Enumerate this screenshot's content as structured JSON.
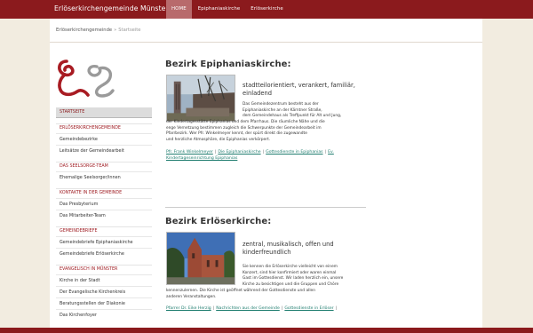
{
  "header": {
    "site_title": "Erlöserkirchengemeinde Münster",
    "nav": [
      {
        "label": "HOME"
      },
      {
        "label": "Epiphaniaskirche"
      },
      {
        "label": "Erlöserkirche"
      }
    ]
  },
  "breadcrumb": {
    "root": "Erlöserkirchengemeinde",
    "separator": "»",
    "current": "Startseite"
  },
  "sidebar": {
    "active": "STARTSEITE",
    "groups": [
      {
        "heading": "ERLÖSERKIRCHENGEMEINDE",
        "items": [
          "Gemeindebezirke",
          "Leitsätze der Gemeindearbeit"
        ]
      },
      {
        "heading": "DAS SEELSORGE-TEAM",
        "items": [
          "Ehemalige Seelsorger/innen"
        ]
      },
      {
        "heading": "KONTAKTE IN DER GEMEINDE",
        "items": [
          "Das Presbyterium",
          "Das Mitarbeiter-Team"
        ]
      },
      {
        "heading": "GEMEINDEBRIEFE",
        "items": [
          "Gemeindebriefe Epiphaniaskirche",
          "Gemeindebriefe Erlöserkirche"
        ]
      },
      {
        "heading": "EVANGELISCH IN MÜNSTER",
        "items": [
          "Kirche in der Stadt",
          "Der Evangelische Kirchenkreis",
          "Beratungsstellen der Diakonie",
          "Das Kirchenfoyer"
        ]
      }
    ]
  },
  "sections": [
    {
      "title": "Bezirk Epiphaniaskirche:",
      "tagline": "stadtteilorientiert, verankert, familiär, einladend",
      "description": [
        "Das Gemeindezentrum besteht aus der",
        "Epiphaniaskirche an der Kärntner Straße,",
        "dem Gemeindehaus als Treffpunkt für Alt und Jung,",
        "der Kindertagesstätte Epiphanias und dem Pfarrhaus. Die räumliche Nähe und die",
        "enge Vernetzung bestimmen zugleich die Schwerpunkte der Gemeindearbeit im",
        "Pfarrbezirk. Wer Pfr. Winkelmeyer kennt, der spürt direkt die zugewandte",
        "und herzliche Atmosphäre, die Epiphanias verkörpert."
      ],
      "links": [
        "Pfr. Frank Winkelmeyer",
        "Die Epiphaniaskirche",
        "Gottesdienste in Epiphanias",
        "Ev. Kindertageseinrichtung Epiphanias"
      ]
    },
    {
      "title": "Bezirk Erlöserkirche:",
      "tagline": "zentral, musikalisch, offen und kinderfreundlich",
      "description": [
        "Sie kennen die Erlöserkirche vielleicht von einem",
        "Konzert, sind hier konfirmiert oder waren einmal",
        "Gast im Gottesdienst. Wir laden herzlich ein, unsere",
        "Kirche zu besichtigen und die Gruppen und Chöre",
        "kennenzulernen. Die Kirche ist geöffnet während der Gottesdienste und allen",
        "anderen Veranstaltungen."
      ],
      "links": [
        "Pfarrer Dr. Eike Herzig",
        "Nachrichten aus der Gemeinde",
        "Gottesdienste in Erlöser"
      ]
    }
  ],
  "colors": {
    "brand": "#8b1a1d",
    "link": "#1f7d6f",
    "nav_active": "#b86a6c"
  }
}
